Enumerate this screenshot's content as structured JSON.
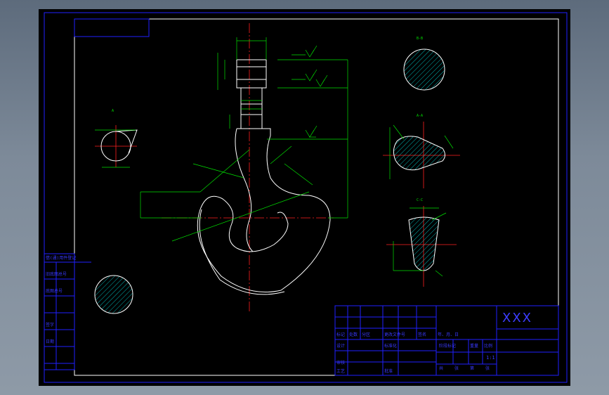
{
  "title_block": {
    "drawing_title": "XXX",
    "scale": "1:1",
    "row_labels": [
      "标记",
      "处数",
      "分区",
      "更改文件号",
      "签名",
      "年、月、日"
    ],
    "sign_labels": [
      "设计",
      "标准化",
      "审核",
      "工艺",
      "批准"
    ],
    "stage_labels": [
      "阶段标记",
      "重量",
      "比例"
    ],
    "sheet_labels": [
      "共",
      "张",
      "第",
      "张"
    ]
  },
  "left_margin_table": {
    "labels": [
      "借(通)用件登记",
      "旧底图总号",
      "底图总号",
      "签字",
      "日期"
    ]
  },
  "section_marks": {
    "top_right": "B-B",
    "left": "A",
    "mid_right_a": "A-A",
    "mid_right_b": "C-C"
  },
  "colors": {
    "frame": "#2020ff",
    "geometry": "#ffffff",
    "dimension": "#00e000",
    "center_line": "#ff2020",
    "hatch": "#00e0e0"
  }
}
